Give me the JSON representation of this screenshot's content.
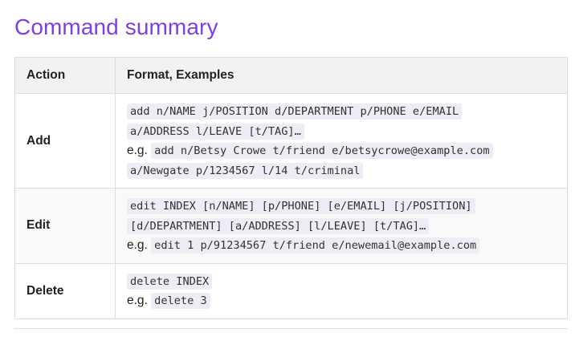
{
  "page": {
    "heading": "Command summary"
  },
  "table": {
    "headers": {
      "action": "Action",
      "format": "Format, Examples"
    },
    "rows": [
      {
        "action": "Add",
        "format_lines": [
          "add n/NAME j/POSITION d/DEPARTMENT p/PHONE e/EMAIL",
          "a/ADDRESS l/LEAVE [t/TAG]…"
        ],
        "example_prefix": "e.g.",
        "example_lines": [
          "add n/Betsy Crowe t/friend e/betsycrowe@example.com",
          "a/Newgate p/1234567 l/14 t/criminal"
        ]
      },
      {
        "action": "Edit",
        "format_lines": [
          "edit INDEX [n/NAME] [p/PHONE] [e/EMAIL] [j/POSITION]",
          "[d/DEPARTMENT] [a/ADDRESS] [l/LEAVE] [t/TAG]…"
        ],
        "example_prefix": "e.g.",
        "example_lines": [
          "edit 1 p/91234567 t/friend e/newemail@example.com"
        ]
      },
      {
        "action": "Delete",
        "format_lines": [
          "delete INDEX"
        ],
        "example_prefix": "e.g.",
        "example_lines": [
          "delete 3"
        ]
      }
    ]
  }
}
